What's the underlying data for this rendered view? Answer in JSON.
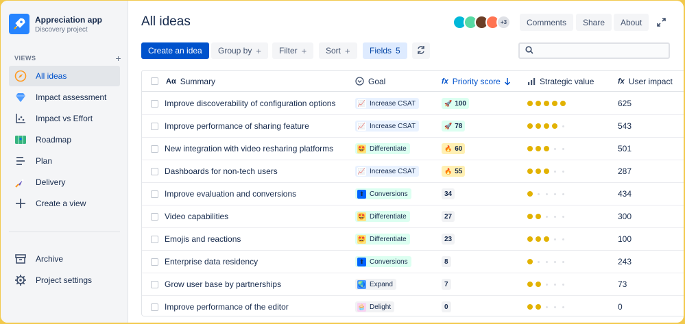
{
  "project": {
    "name": "Appreciation app",
    "subtitle": "Discovery project"
  },
  "sidebar": {
    "views_label": "VIEWS",
    "add_view_glyph": "+",
    "items": [
      {
        "label": "All ideas",
        "icon": "compass-icon",
        "active": true
      },
      {
        "label": "Impact assessment",
        "icon": "diamond-icon"
      },
      {
        "label": "Impact vs Effort",
        "icon": "scatter-chart-icon"
      },
      {
        "label": "Roadmap",
        "icon": "map-icon"
      },
      {
        "label": "Plan",
        "icon": "list-icon"
      },
      {
        "label": "Delivery",
        "icon": "rocket-icon"
      },
      {
        "label": "Create a view",
        "icon": "plus-icon"
      }
    ],
    "bottom_items": [
      {
        "label": "Archive",
        "icon": "archive-icon"
      },
      {
        "label": "Project settings",
        "icon": "gear-icon"
      }
    ]
  },
  "header": {
    "title": "All ideas",
    "avatars_more": "+3",
    "comments_label": "Comments",
    "share_label": "Share",
    "about_label": "About"
  },
  "toolbar": {
    "create_label": "Create an idea",
    "group_by_label": "Group by",
    "filter_label": "Filter",
    "sort_label": "Sort",
    "fields_label": "Fields",
    "fields_count": "5",
    "plus_glyph": "+",
    "search_placeholder": ""
  },
  "table": {
    "columns": {
      "summary": "Summary",
      "summary_icon": "Aα",
      "goal": "Goal",
      "priority": "Priority score",
      "strategic": "Strategic value",
      "impact": "User impact",
      "fx_icon": "fx"
    },
    "rows": [
      {
        "summary": "Improve discoverability of configuration options",
        "goal": "Increase CSAT",
        "goal_icon": "chart-emoji",
        "priority": "100",
        "priority_icon": "rocket-emoji",
        "strategic": 5,
        "impact": "625"
      },
      {
        "summary": "Improve performance of sharing feature",
        "goal": "Increase CSAT",
        "goal_icon": "chart-emoji",
        "priority": "78",
        "priority_icon": "rocket-emoji",
        "strategic": 4,
        "impact": "543"
      },
      {
        "summary": "New integration with video resharing platforms",
        "goal": "Differentiate",
        "goal_icon": "star-struck-emoji",
        "priority": "60",
        "priority_icon": "fire-emoji",
        "strategic": 3,
        "impact": "501"
      },
      {
        "summary": "Dashboards for non-tech users",
        "goal": "Increase CSAT",
        "goal_icon": "chart-emoji",
        "priority": "55",
        "priority_icon": "fire-emoji",
        "strategic": 3,
        "impact": "287"
      },
      {
        "summary": "Improve evaluation and conversions",
        "goal": "Conversions",
        "goal_icon": "up-arrow-emoji",
        "priority": "34",
        "priority_icon": "",
        "strategic": 1,
        "impact": "434"
      },
      {
        "summary": "Video capabilities",
        "goal": "Differentiate",
        "goal_icon": "star-struck-emoji",
        "priority": "27",
        "priority_icon": "",
        "strategic": 2,
        "impact": "300"
      },
      {
        "summary": "Emojis and reactions",
        "goal": "Differentiate",
        "goal_icon": "star-struck-emoji",
        "priority": "23",
        "priority_icon": "",
        "strategic": 3,
        "impact": "100"
      },
      {
        "summary": "Enterprise data residency",
        "goal": "Conversions",
        "goal_icon": "up-arrow-emoji",
        "priority": "8",
        "priority_icon": "",
        "strategic": 1,
        "impact": "243"
      },
      {
        "summary": "Grow user base by partnerships",
        "goal": "Expand",
        "goal_icon": "globe-emoji",
        "priority": "7",
        "priority_icon": "",
        "strategic": 2,
        "impact": "73"
      },
      {
        "summary": "Improve performance of the editor",
        "goal": "Delight",
        "goal_icon": "cupcake-emoji",
        "priority": "0",
        "priority_icon": "",
        "strategic": 2,
        "impact": "0"
      }
    ]
  },
  "colors": {
    "primary": "#0052cc",
    "star_on": "#e2b203",
    "tag_csat": "#e9f2ff",
    "tag_diff": "#dcfff1",
    "tag_conv": "#dcfff1",
    "tag_expand": "#f1f2f4",
    "tag_delight": "#f1f2f4",
    "score_hot": "#fff0b3",
    "score_green": "#dcfff1",
    "score_plain": "#f1f2f4"
  }
}
